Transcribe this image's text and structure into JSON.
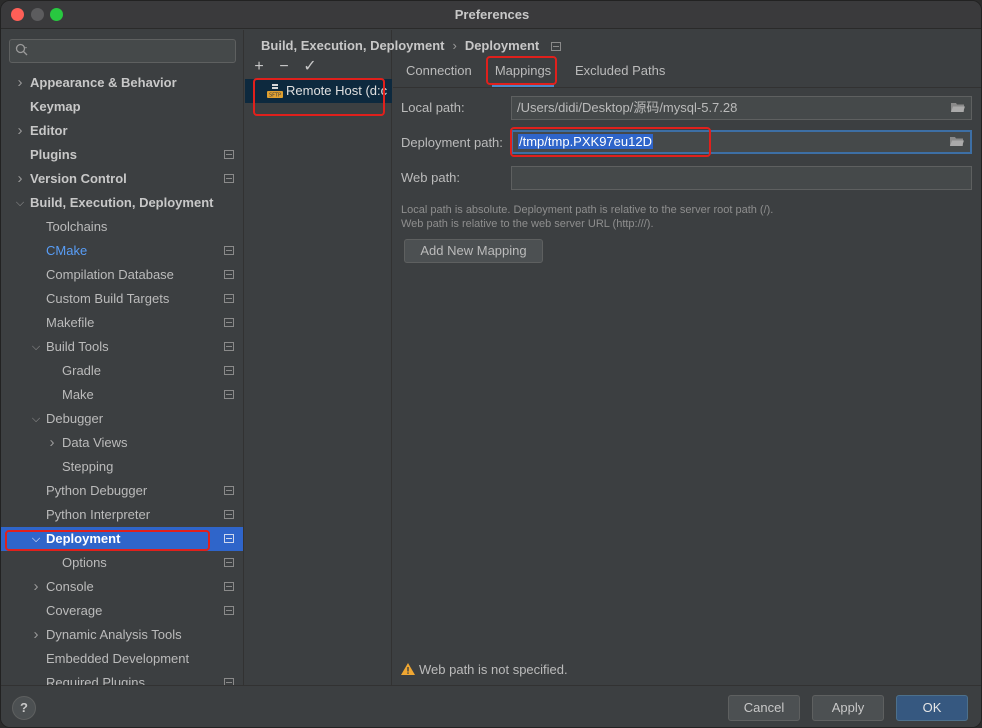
{
  "window": {
    "title": "Preferences"
  },
  "search": {
    "placeholder": ""
  },
  "sidebar": {
    "items": [
      {
        "label": "Appearance & Behavior",
        "bold": true,
        "arrow": "right",
        "indent": 0,
        "proj": false
      },
      {
        "label": "Keymap",
        "bold": true,
        "arrow": "",
        "indent": 0,
        "proj": false
      },
      {
        "label": "Editor",
        "bold": true,
        "arrow": "right",
        "indent": 0,
        "proj": false
      },
      {
        "label": "Plugins",
        "bold": true,
        "arrow": "",
        "indent": 0,
        "proj": true
      },
      {
        "label": "Version Control",
        "bold": true,
        "arrow": "right",
        "indent": 0,
        "proj": true
      },
      {
        "label": "Build, Execution, Deployment",
        "bold": true,
        "arrow": "down",
        "indent": 0,
        "proj": false
      },
      {
        "label": "Toolchains",
        "arrow": "",
        "indent": 1,
        "proj": false
      },
      {
        "label": "CMake",
        "arrow": "",
        "indent": 1,
        "proj": true,
        "link": true
      },
      {
        "label": "Compilation Database",
        "arrow": "",
        "indent": 1,
        "proj": true
      },
      {
        "label": "Custom Build Targets",
        "arrow": "",
        "indent": 1,
        "proj": true
      },
      {
        "label": "Makefile",
        "arrow": "",
        "indent": 1,
        "proj": true
      },
      {
        "label": "Build Tools",
        "arrow": "down",
        "indent": 1,
        "proj": true
      },
      {
        "label": "Gradle",
        "arrow": "",
        "indent": 2,
        "proj": true
      },
      {
        "label": "Make",
        "arrow": "",
        "indent": 2,
        "proj": true
      },
      {
        "label": "Debugger",
        "arrow": "down",
        "indent": 1,
        "proj": false
      },
      {
        "label": "Data Views",
        "arrow": "right",
        "indent": 2,
        "proj": false
      },
      {
        "label": "Stepping",
        "arrow": "",
        "indent": 2,
        "proj": false
      },
      {
        "label": "Python Debugger",
        "arrow": "",
        "indent": 1,
        "proj": true
      },
      {
        "label": "Python Interpreter",
        "arrow": "",
        "indent": 1,
        "proj": true
      },
      {
        "label": "Deployment",
        "arrow": "down",
        "indent": 1,
        "proj": true,
        "selected": true
      },
      {
        "label": "Options",
        "arrow": "",
        "indent": 2,
        "proj": true
      },
      {
        "label": "Console",
        "arrow": "right",
        "indent": 1,
        "proj": true
      },
      {
        "label": "Coverage",
        "arrow": "",
        "indent": 1,
        "proj": true
      },
      {
        "label": "Dynamic Analysis Tools",
        "arrow": "right",
        "indent": 1,
        "proj": false
      },
      {
        "label": "Embedded Development",
        "arrow": "",
        "indent": 1,
        "proj": false
      },
      {
        "label": "Required Plugins",
        "arrow": "",
        "indent": 1,
        "proj": true
      }
    ]
  },
  "servers": {
    "toolbar": {
      "add": "+",
      "remove": "−",
      "apply": "✓"
    },
    "items": [
      {
        "label": "Remote Host (d:c",
        "icon": "sftp-server-icon"
      }
    ]
  },
  "breadcrumb": {
    "parent": "Build, Execution, Deployment",
    "separator": "›",
    "current": "Deployment"
  },
  "tabs": [
    {
      "label": "Connection",
      "active": false
    },
    {
      "label": "Mappings",
      "active": true
    },
    {
      "label": "Excluded Paths",
      "active": false
    }
  ],
  "mappings": {
    "local_path_label": "Local path:",
    "local_path_value": "/Users/didi/Desktop/源码/mysql-5.7.28",
    "deployment_path_label": "Deployment path:",
    "deployment_path_value": "/tmp/tmp.PXK97eu12D",
    "web_path_label": "Web path:",
    "web_path_value": "",
    "hint_line1": "Local path is absolute. Deployment path is relative to the server root path (/).",
    "hint_line2": "Web path is relative to the web server URL (http:///).",
    "add_mapping_label": "Add New Mapping",
    "warning": "Web path is not specified."
  },
  "footer": {
    "help": "?",
    "cancel": "Cancel",
    "apply": "Apply",
    "ok": "OK"
  },
  "colors": {
    "accent": "#2f65ca",
    "annotation": "#e0201c",
    "link": "#589df6",
    "warning": "#f0a732"
  }
}
